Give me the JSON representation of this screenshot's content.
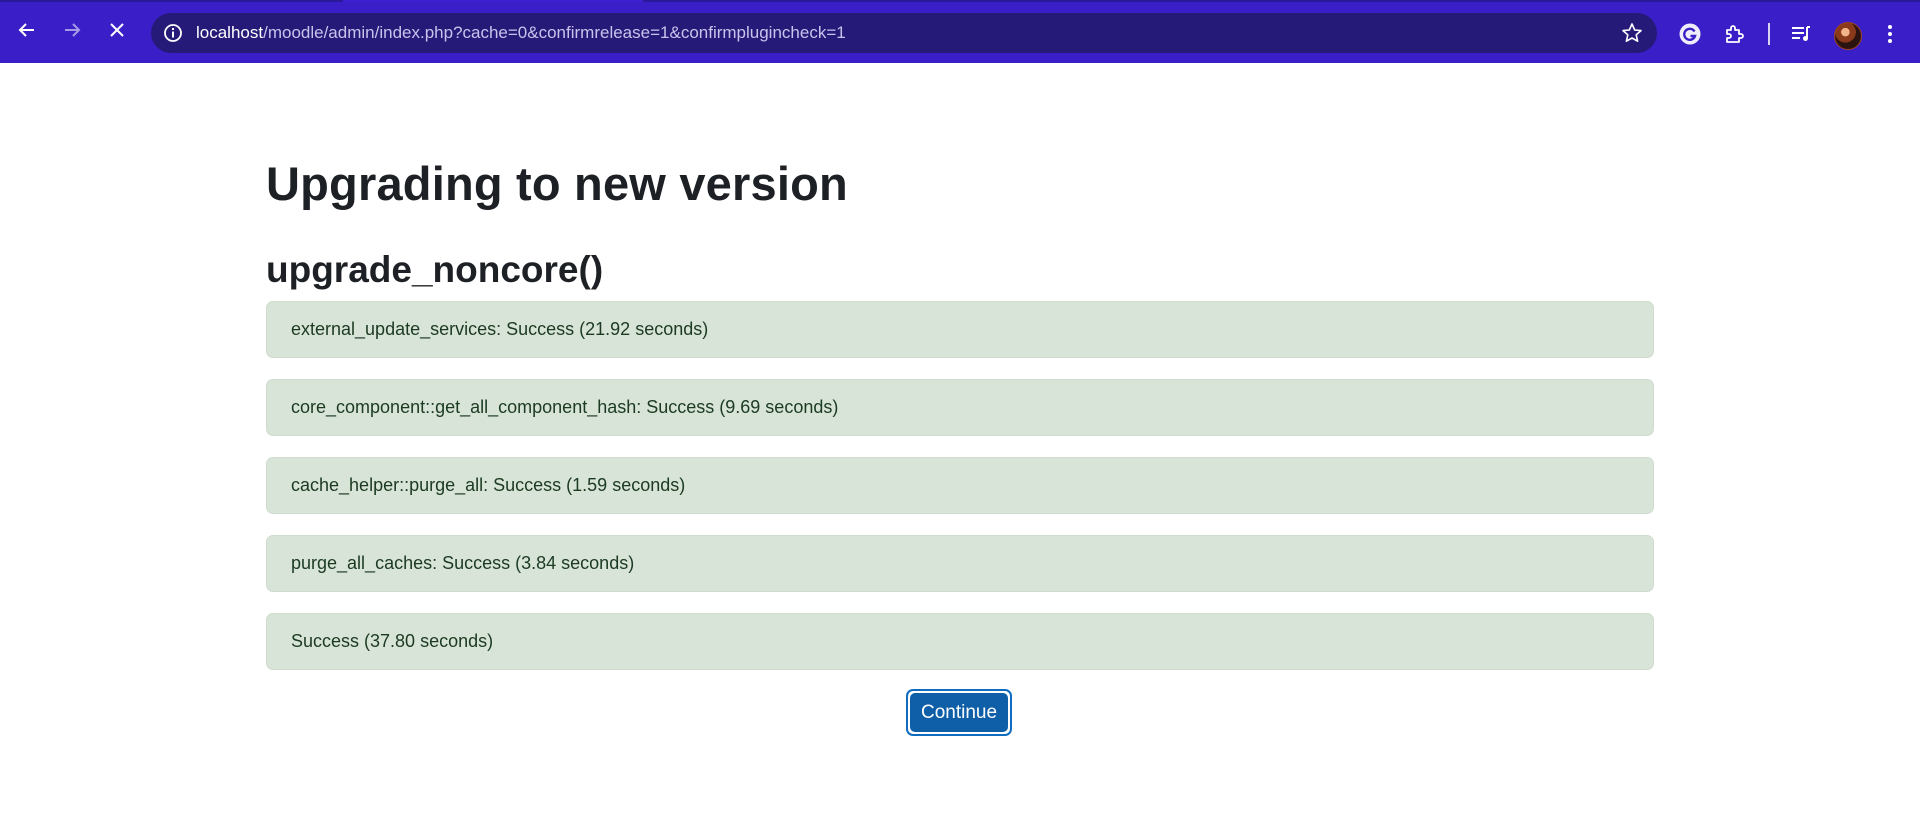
{
  "browser": {
    "url_host": "localhost",
    "url_path": "/moodle/admin/index.php?cache=0&confirmrelease=1&confirmplugincheck=1",
    "icons": {
      "back": "back-arrow-icon",
      "forward": "forward-arrow-icon",
      "stop": "close-icon",
      "site_info": "info-icon",
      "bookmark": "star-icon",
      "grammarly": "grammarly-icon",
      "extensions": "puzzle-icon",
      "media": "queue-music-icon",
      "profile": "avatar",
      "menu": "more-vert-icon"
    },
    "colors": {
      "toolbar": "#3a1fc9",
      "omnibox": "#261a78"
    }
  },
  "page": {
    "title": "Upgrading to new version",
    "section_title": "upgrade_noncore()",
    "results": [
      "external_update_services: Success (21.92 seconds)",
      "core_component::get_all_component_hash: Success (9.69 seconds)",
      "cache_helper::purge_all: Success (1.59 seconds)",
      "purge_all_caches: Success (3.84 seconds)",
      "Success (37.80 seconds)"
    ],
    "continue_label": "Continue",
    "colors": {
      "success_bg": "#d7e4d7",
      "success_text": "#1c3a22",
      "button": "#0f5fa8"
    }
  }
}
